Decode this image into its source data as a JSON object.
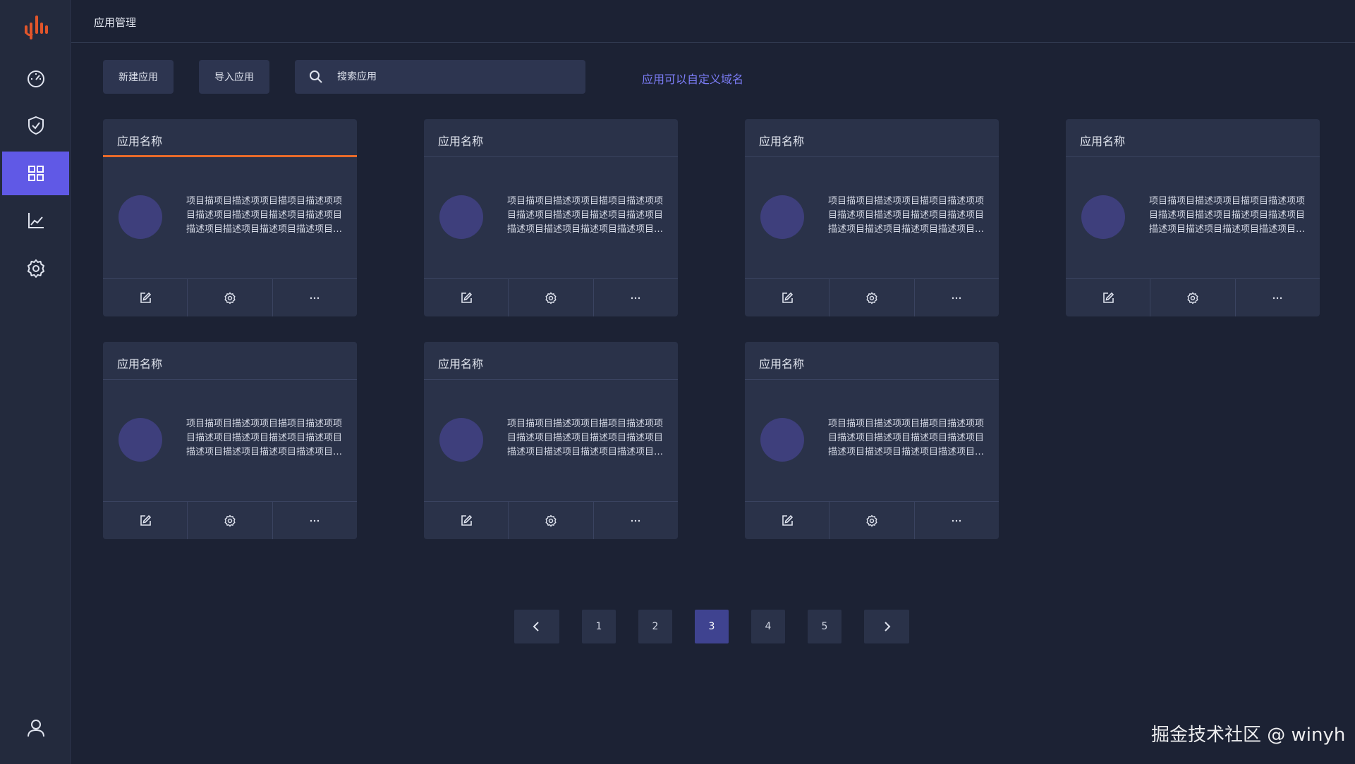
{
  "header": {
    "title": "应用管理"
  },
  "sidebar": {
    "items": [
      {
        "icon": "dashboard-icon"
      },
      {
        "icon": "shield-check-icon"
      },
      {
        "icon": "grid-apps-icon",
        "active": true
      },
      {
        "icon": "line-chart-icon"
      },
      {
        "icon": "gear-icon"
      }
    ],
    "bottom": {
      "icon": "user-icon"
    }
  },
  "toolbar": {
    "new_label": "新建应用",
    "import_label": "导入应用",
    "search_placeholder": "搜索应用",
    "link_label": "应用可以自定义域名"
  },
  "cards": [
    {
      "title": "应用名称",
      "desc": "项目描项目描述项项目描项目描述项项目描述项目描述项目描述项目描述项目描述项目描述项目描述项目描述项目描述...",
      "active": true
    },
    {
      "title": "应用名称",
      "desc": "项目描项目描述项项目描项目描述项项目描述项目描述项目描述项目描述项目描述项目描述项目描述项目描述项目描述..."
    },
    {
      "title": "应用名称",
      "desc": "项目描项目描述项项目描项目描述项项目描述项目描述项目描述项目描述项目描述项目描述项目描述项目描述项目描述..."
    },
    {
      "title": "应用名称",
      "desc": "项目描项目描述项项目描项目描述项项目描述项目描述项目描述项目描述项目描述项目描述项目描述项目描述项目描述..."
    },
    {
      "title": "应用名称",
      "desc": "项目描项目描述项项目描项目描述项项目描述项目描述项目描述项目描述项目描述项目描述项目描述项目描述项目描述..."
    },
    {
      "title": "应用名称",
      "desc": "项目描项目描述项项目描项目描述项项目描述项目描述项目描述项目描述项目描述项目描述项目描述项目描述项目描述..."
    },
    {
      "title": "应用名称",
      "desc": "项目描项目描述项项目描项目描述项项目描述项目描述项目描述项目描述项目描述项目描述项目描述项目描述项目描述..."
    }
  ],
  "card_actions": [
    "edit-icon",
    "gear-icon",
    "more-icon"
  ],
  "pagination": {
    "pages": [
      "1",
      "2",
      "3",
      "4",
      "5"
    ],
    "current": "3",
    "prev_icon": "chevron-left-icon",
    "next_icon": "chevron-right-icon"
  },
  "watermark": "掘金技术社区 @ winyh",
  "colors": {
    "background": "#1c2234",
    "sidebar": "#232a3d",
    "card": "#2a3249",
    "accent": "#6059e6",
    "active_underline": "#e86a2a",
    "link": "#7b7cf5",
    "logo": "#e0552b"
  }
}
